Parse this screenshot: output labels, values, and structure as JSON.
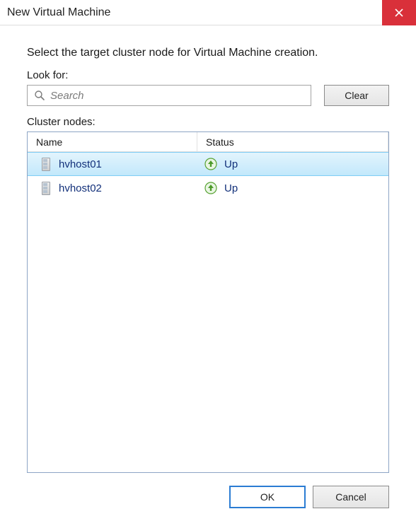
{
  "window": {
    "title": "New Virtual Machine"
  },
  "instruction": "Select the target cluster node for Virtual Machine creation.",
  "lookFor": {
    "label": "Look for:",
    "placeholder": "Search",
    "value": "",
    "clear_label": "Clear"
  },
  "clusterNodes": {
    "label": "Cluster nodes:",
    "columns": {
      "name": "Name",
      "status": "Status"
    },
    "rows": [
      {
        "name": "hvhost01",
        "status": "Up",
        "selected": true
      },
      {
        "name": "hvhost02",
        "status": "Up",
        "selected": false
      }
    ]
  },
  "buttons": {
    "ok": "OK",
    "cancel": "Cancel"
  }
}
